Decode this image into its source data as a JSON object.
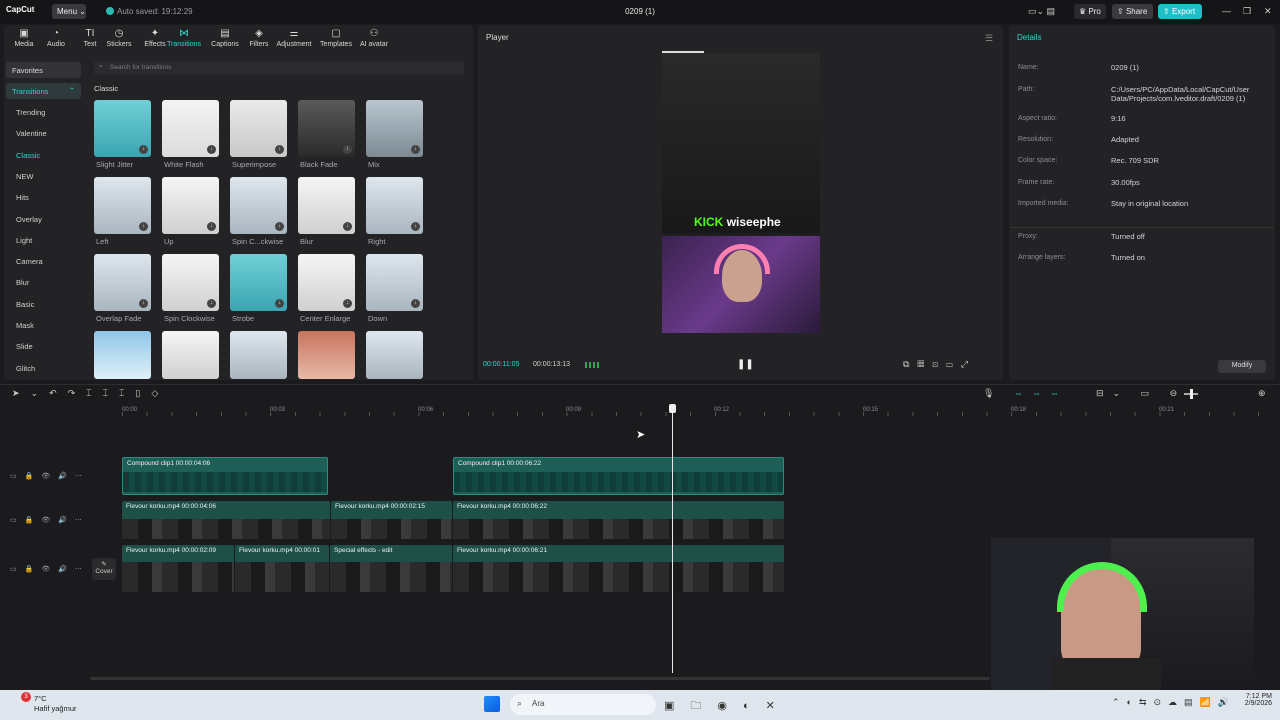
{
  "titlebar": {
    "app": "CapCut",
    "menu": "Menu",
    "autosave": "Auto saved: 19:12:29",
    "project": "0209 (1)",
    "pro": "Pro",
    "share": "Share",
    "export": "Export"
  },
  "categories": [
    {
      "label": "Media",
      "icon": "▣"
    },
    {
      "label": "Audio",
      "icon": "◔"
    },
    {
      "label": "Text",
      "icon": "TI"
    },
    {
      "label": "Stickers",
      "icon": "◷"
    },
    {
      "label": "Effects",
      "icon": "✦"
    },
    {
      "label": "Transitions",
      "icon": "⋈"
    },
    {
      "label": "Captions",
      "icon": "▤"
    },
    {
      "label": "Filters",
      "icon": "◈"
    },
    {
      "label": "Adjustment",
      "icon": "⚌"
    },
    {
      "label": "Templates",
      "icon": "▢"
    },
    {
      "label": "AI avatar",
      "icon": "⚇"
    }
  ],
  "sidebar": {
    "favorites": "Favorites",
    "transitions": "Transitions",
    "items": [
      "Trending",
      "Valentine",
      "Classic",
      "NEW",
      "Hits",
      "Overlay",
      "Light",
      "Camera",
      "Blur",
      "Basic",
      "Mask",
      "Slide",
      "Glitch"
    ]
  },
  "search": {
    "placeholder": "Search for transitions"
  },
  "section": "Classic",
  "transitions": [
    "Slight Jitter",
    "White Flash",
    "Superimpose",
    "Black Fade",
    "Mix",
    "Left",
    "Up",
    "Spin C...ckwise",
    "Blur",
    "Right",
    "Overlap Fade",
    "Spin Clockwise",
    "Strobe",
    "Center Enlarge",
    "Down",
    "",
    "",
    "",
    "",
    ""
  ],
  "player": {
    "title": "Player",
    "overlay_text": "KICK wiseephe",
    "kick": "KICK",
    "user": "wiseephe",
    "current": "00:00:11:05",
    "total": "00:00:13:13"
  },
  "details": {
    "title": "Details",
    "rows": [
      {
        "k": "Name:",
        "v": "0209 (1)"
      },
      {
        "k": "Path:",
        "v": "C:/Users/PC/AppData/Local/CapCut/User Data/Projects/com.lveditor.draft/0209 (1)"
      },
      {
        "k": "Aspect ratio:",
        "v": "9:16"
      },
      {
        "k": "Resolution:",
        "v": "Adapted"
      },
      {
        "k": "Color space:",
        "v": "Rec. 709 SDR"
      },
      {
        "k": "Frame rate:",
        "v": "30.00fps"
      },
      {
        "k": "Imported media:",
        "v": "Stay in original location"
      },
      {
        "k": "Proxy:",
        "v": "Turned off"
      },
      {
        "k": "Arrange layers:",
        "v": "Turned on"
      }
    ],
    "modify": "Modify"
  },
  "ruler": [
    "00:00",
    "00:03",
    "00:06",
    "00:09",
    "00:12",
    "00:15",
    "00:18",
    "00:21"
  ],
  "clips": {
    "c1": "Compound clip1  00:00:04:06",
    "c2": "Compound clip1  00:00:06:22",
    "v1": "Flevour korku.mp4  00:00:04:06",
    "v2": "Flevour korku.mp4  00:00:02:15",
    "v3": "Flevour korku.mp4  00:00:06:22",
    "m1": "Flevour korku.mp4  00:00:02:09",
    "m2": "Flevour korku.mp4  00:00:01",
    "m3": "Special effects - edit",
    "m4": "Flevour korku.mp4  00:00:06:21"
  },
  "cover": "Cover",
  "taskbar": {
    "temp": "7°C",
    "weather": "Hafif yağmur",
    "search": "Ara",
    "time": "7:12 PM",
    "date": "2/9/2026",
    "badge": "3"
  }
}
